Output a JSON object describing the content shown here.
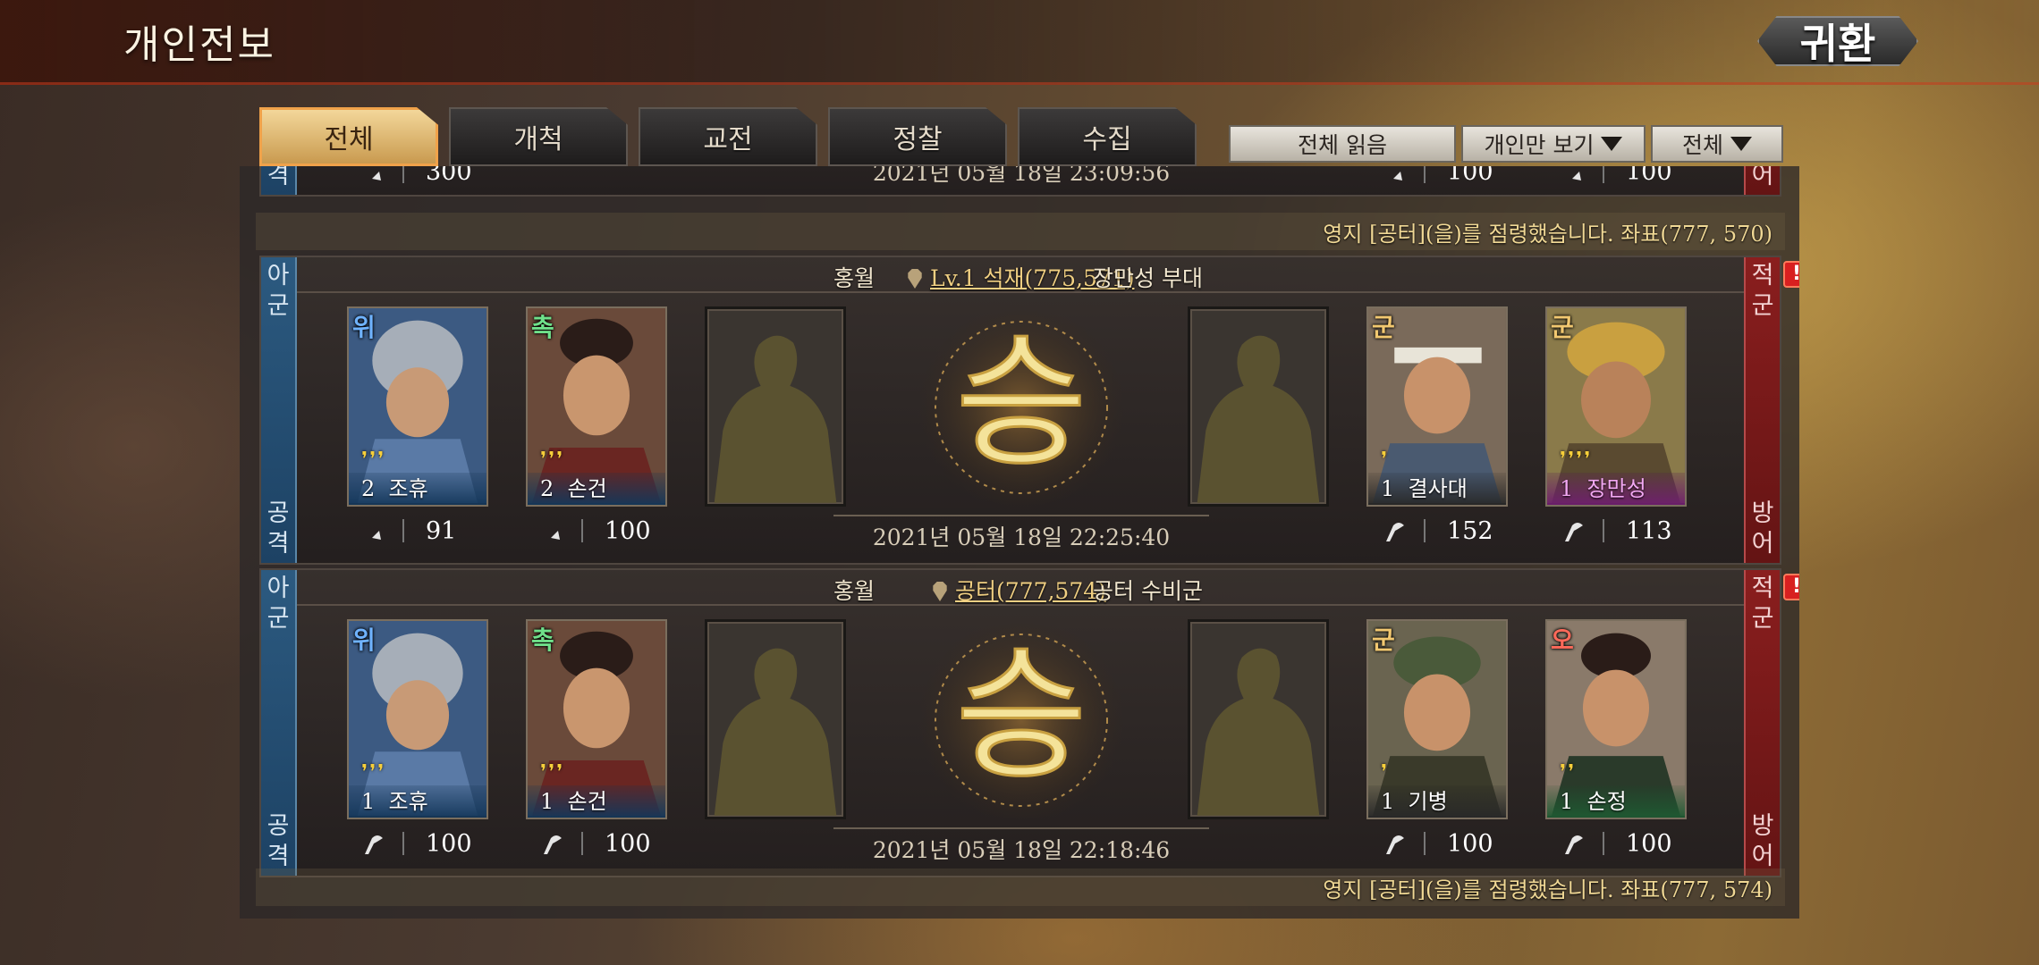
{
  "header": {
    "title": "개인전보",
    "return_label": "귀환"
  },
  "tabs": [
    {
      "label": "전체",
      "active": true
    },
    {
      "label": "개척",
      "active": false
    },
    {
      "label": "교전",
      "active": false
    },
    {
      "label": "정찰",
      "active": false
    },
    {
      "label": "수집",
      "active": false
    }
  ],
  "filters": {
    "read_all": "전체 읽음",
    "personal_only": "개인만 보기",
    "all": "전체"
  },
  "partial_record": {
    "ally_bottom": "격",
    "enemy_bottom": "어",
    "stat_left": "300",
    "time": "2021년 05월 18일 23:09:56",
    "stat_r1": "100",
    "stat_r2": "100",
    "notice": "영지 [공터](을)를 점령했습니다. 좌표(777, 570)"
  },
  "records": [
    {
      "ally_top": "아군",
      "ally_bottom": "공격",
      "enemy_top": "적군",
      "enemy_bottom": "방어",
      "attacker": "홍월",
      "location": "Lv.1 석재(775,571)",
      "defender": "장만성 부대",
      "result": "승",
      "time": "2021년 05월 18일 22:25:40",
      "heroes": [
        {
          "faction": "위",
          "stars": "❜❜❜",
          "level": "2",
          "name": "조휴",
          "value": "91"
        },
        {
          "faction": "촉",
          "stars": "❜❜❜",
          "level": "2",
          "name": "손건",
          "value": "100"
        },
        {
          "faction": "군",
          "stars": "❜",
          "level": "1",
          "name": "결사대",
          "value": "152"
        },
        {
          "faction": "군",
          "stars": "❜❜❜❜",
          "level": "1",
          "name": "장만성",
          "value": "113"
        }
      ]
    },
    {
      "ally_top": "아군",
      "ally_bottom": "공격",
      "enemy_top": "적군",
      "enemy_bottom": "방어",
      "attacker": "홍월",
      "location": "공터(777,574)",
      "defender": "공터 수비군",
      "result": "승",
      "time": "2021년 05월 18일 22:18:46",
      "heroes": [
        {
          "faction": "위",
          "stars": "❜❜❜",
          "level": "1",
          "name": "조휴",
          "value": "100"
        },
        {
          "faction": "촉",
          "stars": "❜❜❜",
          "level": "1",
          "name": "손건",
          "value": "100"
        },
        {
          "faction": "군",
          "stars": "❜",
          "level": "1",
          "name": "기병",
          "value": "100"
        },
        {
          "faction": "오",
          "stars": "❜❜",
          "level": "1",
          "name": "손정",
          "value": "100"
        }
      ],
      "notice": "영지 [공터](을)를 점령했습니다. 좌표(777, 574)"
    }
  ],
  "colors": {
    "ally": "#1d4264",
    "enemy": "#641414",
    "gold": "#f0cf82",
    "wei": "#6fb3ff",
    "shu": "#6fe08a",
    "wu": "#ff6a5a",
    "neutral": "#f2c870"
  }
}
